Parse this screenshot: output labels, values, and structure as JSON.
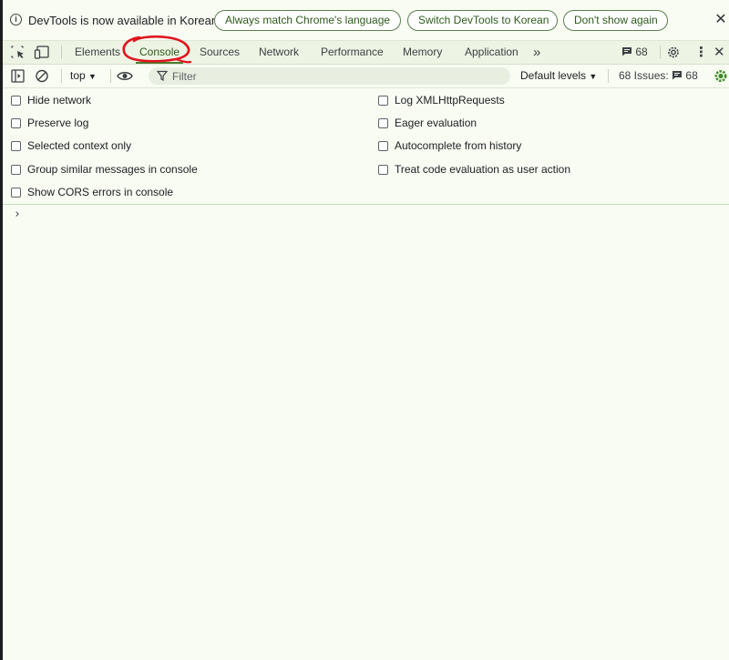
{
  "infobar": {
    "message": "DevTools is now available in Korean!",
    "buttons": {
      "match_language": "Always match Chrome's language",
      "switch_korean": "Switch DevTools to Korean",
      "dont_show": "Don't show again"
    },
    "close_glyph": "✕"
  },
  "tabs": {
    "items": [
      "Elements",
      "Console",
      "Sources",
      "Network",
      "Performance",
      "Memory",
      "Application"
    ],
    "active": "Console",
    "more_glyph": "»",
    "issues_badge": "68",
    "close_glyph": "✕",
    "menu_glyph": "⋮"
  },
  "console_toolbar": {
    "context": "top",
    "filter_placeholder": "Filter",
    "levels": "Default levels",
    "issues_label": "68 Issues:",
    "issues_count": "68"
  },
  "settings": {
    "left": [
      "Hide network",
      "Preserve log",
      "Selected context only",
      "Group similar messages in console",
      "Show CORS errors in console"
    ],
    "right": [
      "Log XMLHttpRequests",
      "Eager evaluation",
      "Autocomplete from history",
      "Treat code evaluation as user action"
    ]
  },
  "console": {
    "prompt": "›"
  },
  "colors": {
    "background": "#f8fcf3",
    "accent": "#4d7c2f",
    "annotation": "#e0141e"
  },
  "icons": {
    "info": "info-icon",
    "inspect": "inspect-element-icon",
    "device": "device-toggle-icon",
    "messages": "message-icon",
    "settings": "gear-icon",
    "sidebar": "sidebar-toggle-icon",
    "clear": "clear-console-icon",
    "eye": "eye-icon",
    "filter": "filter-icon"
  }
}
